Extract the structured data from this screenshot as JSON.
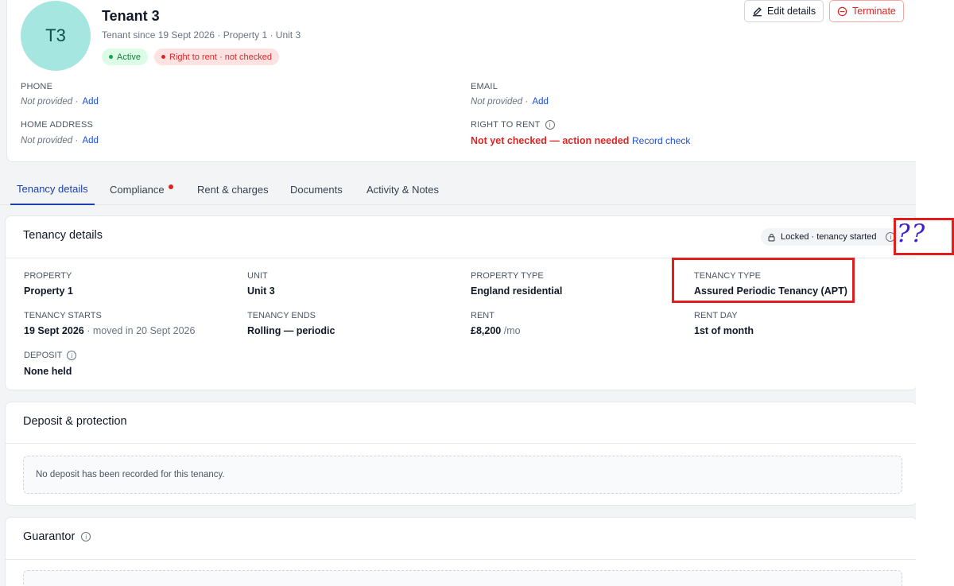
{
  "header": {
    "avatar_initials": "T3",
    "name": "Tenant 3",
    "subtitle": "Tenant since 19 Sept 2026 · Property 1 · Unit 3",
    "status_active": "Active",
    "status_rtr": "Right to rent · not checked",
    "edit_button": "Edit details",
    "terminate_button": "Terminate"
  },
  "contact": {
    "phone_label": "PHONE",
    "phone_value": "Not provided ·",
    "phone_link": "Add",
    "email_label": "EMAIL",
    "email_value": "Not provided ·",
    "email_link": "Add",
    "address_label": "HOME ADDRESS",
    "address_value": "Not provided ·",
    "address_link": "Add",
    "rtr_label": "RIGHT TO RENT",
    "rtr_value": "Not yet checked — action needed",
    "rtr_link": "Record check"
  },
  "tabs": [
    {
      "label": "Tenancy details",
      "active": true
    },
    {
      "label": "Compliance",
      "alert": true
    },
    {
      "label": "Rent & charges"
    },
    {
      "label": "Documents"
    },
    {
      "label": "Activity & Notes"
    }
  ],
  "tenancy": {
    "title": "Tenancy details",
    "locked_badge": "Locked · tenancy started",
    "property_label": "PROPERTY",
    "property_value": "Property 1",
    "unit_label": "UNIT",
    "unit_value": "Unit 3",
    "property_type_label": "PROPERTY TYPE",
    "property_type_value": "England residential",
    "tenancy_type_label": "TENANCY TYPE",
    "tenancy_type_value": "Assured Periodic Tenancy (APT)",
    "starts_label": "TENANCY STARTS",
    "starts_value": "19 Sept 2026",
    "starts_note": "· moved in 20 Sept 2026",
    "ends_label": "TENANCY ENDS",
    "ends_value": "Rolling — periodic",
    "rent_label": "RENT",
    "rent_value": "£8,200",
    "rent_period": "/mo",
    "rent_day_label": "RENT DAY",
    "rent_day_value": "1st of month",
    "deposit_label": "DEPOSIT",
    "deposit_value": "None held"
  },
  "deposit": {
    "title": "Deposit & protection",
    "empty_text": "No deposit has been recorded for this tenancy."
  },
  "guarantor": {
    "title": "Guarantor"
  },
  "annotation": {
    "question_marks": "??",
    "color_box": "#e11d1d",
    "color_marks": "#3b1fd6"
  },
  "colors": {
    "accent": "#1e40af",
    "danger": "#dc2626",
    "success": "#16a34a",
    "avatar_bg": "#a5e6e0"
  }
}
